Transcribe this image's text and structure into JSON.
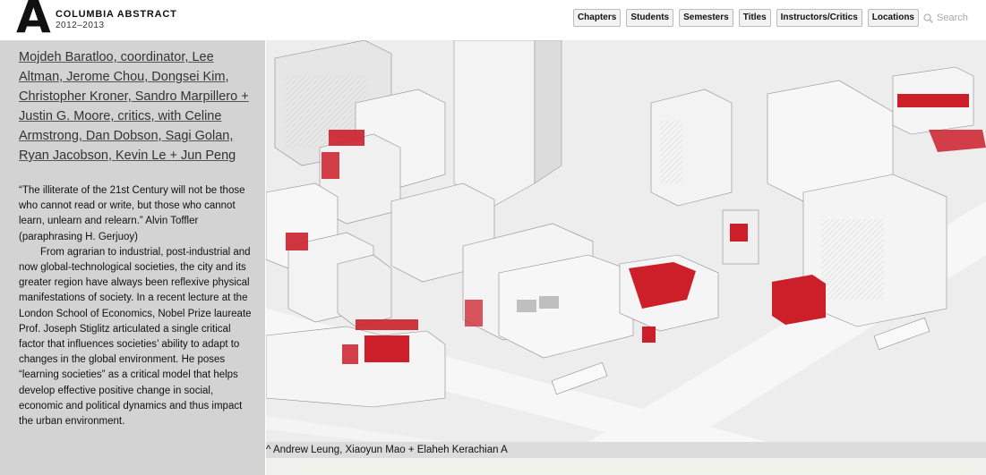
{
  "header": {
    "logo_letter": "A",
    "site_title": "COLUMBIA ABSTRACT",
    "years": "2012–2013",
    "nav": [
      "Chapters",
      "Students",
      "Semesters",
      "Titles",
      "Instructors/Critics",
      "Locations"
    ],
    "search_placeholder": "Search",
    "search_icon": "search-icon"
  },
  "sidebar": {
    "critics": "Mojdeh Baratloo, coordinator, Lee Altman, Jerome Chou, Dongsei Kim, Christopher Kroner, Sandro Marpillero + Justin G. Moore, critics, with Celine Armstrong, Dan Dobson, Sagi Golan, Ryan Jacobson, Kevin Le + Jun Peng",
    "quote": "“The illiterate of the 21st Century will not be those who cannot read or write, but those who cannot learn, unlearn and relearn.” Alvin Toffler (paraphrasing H. Gerjuoy)",
    "body": "From agrarian to industrial, post-industrial and now global-technological societies, the city and its greater region have always been reflexive physical manifestations of society. In a recent lecture at the London School of Economics, Nobel Prize laureate Prof. Joseph Stiglitz articulated a single critical factor that influences societies’ ability to adapt to changes in the global environment. He poses “learning societies” as a critical model that helps develop effective positive change in social, economic and political dynamics and thus impact the urban environment."
  },
  "main": {
    "image_caption": "^ Andrew Leung, Xiaoyun Mao + Elaheh Kerachian A",
    "accent_color": "#cc1f2a"
  }
}
